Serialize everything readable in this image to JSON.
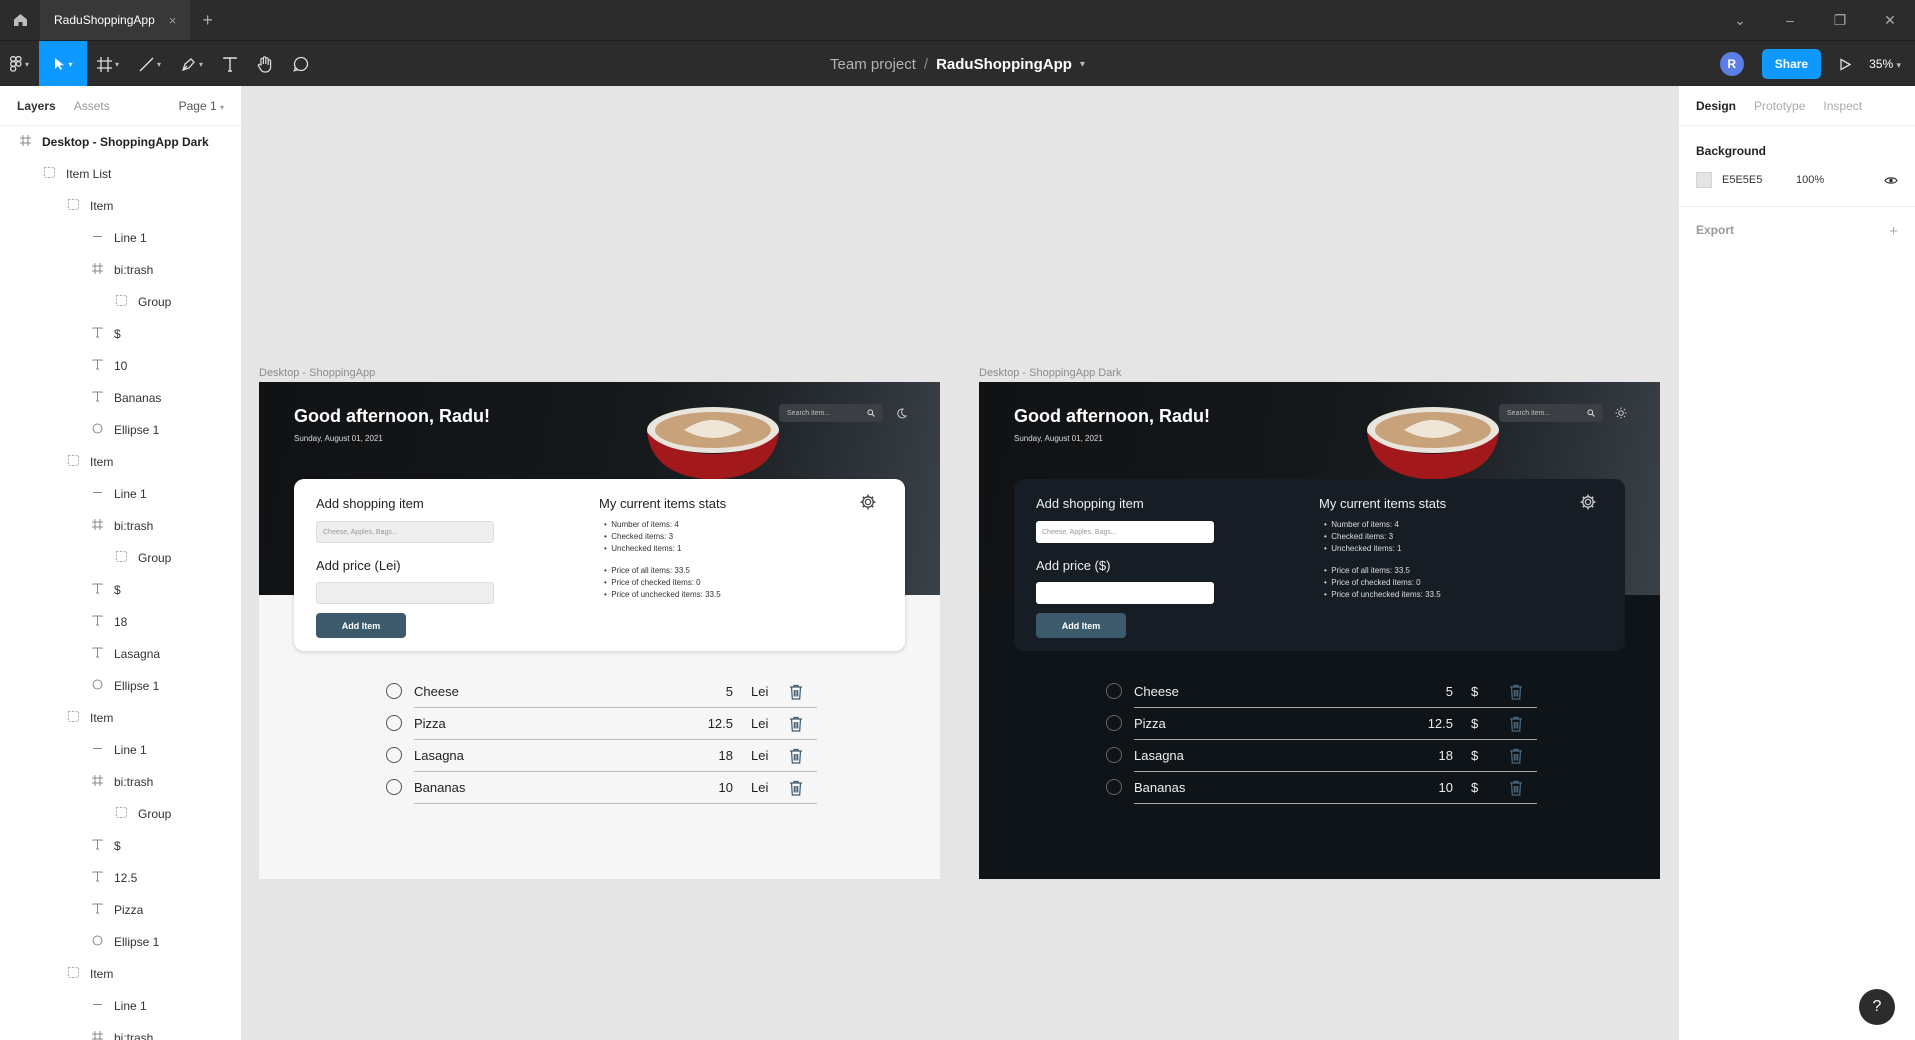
{
  "tabbar": {
    "tab_title": "RaduShoppingApp",
    "close": "×",
    "new_tab": "+"
  },
  "toolbar": {
    "project": "Team project",
    "separator": "/",
    "file": "RaduShoppingApp",
    "avatar": "R",
    "share": "Share",
    "zoom": "35%"
  },
  "left_panel": {
    "tabs": [
      "Layers",
      "Assets"
    ],
    "page": "Page 1",
    "layers": [
      {
        "label": "Desktop - ShoppingApp Dark",
        "icon": "frame-icon",
        "depth": 0
      },
      {
        "label": "Item List",
        "icon": "group-icon",
        "depth": 1
      },
      {
        "label": "Item",
        "icon": "group-icon",
        "depth": 2
      },
      {
        "label": "Line 1",
        "icon": "line-icon",
        "depth": 3
      },
      {
        "label": "bi:trash",
        "icon": "frame-icon",
        "depth": 3
      },
      {
        "label": "Group",
        "icon": "group-icon",
        "depth": 4
      },
      {
        "label": "$",
        "icon": "text-icon",
        "depth": 3
      },
      {
        "label": "10",
        "icon": "text-icon",
        "depth": 3
      },
      {
        "label": "Bananas",
        "icon": "text-icon",
        "depth": 3
      },
      {
        "label": "Ellipse 1",
        "icon": "ellipse-icon",
        "depth": 3
      },
      {
        "label": "Item",
        "icon": "group-icon",
        "depth": 2
      },
      {
        "label": "Line 1",
        "icon": "line-icon",
        "depth": 3
      },
      {
        "label": "bi:trash",
        "icon": "frame-icon",
        "depth": 3
      },
      {
        "label": "Group",
        "icon": "group-icon",
        "depth": 4
      },
      {
        "label": "$",
        "icon": "text-icon",
        "depth": 3
      },
      {
        "label": "18",
        "icon": "text-icon",
        "depth": 3
      },
      {
        "label": "Lasagna",
        "icon": "text-icon",
        "depth": 3
      },
      {
        "label": "Ellipse 1",
        "icon": "ellipse-icon",
        "depth": 3
      },
      {
        "label": "Item",
        "icon": "group-icon",
        "depth": 2
      },
      {
        "label": "Line 1",
        "icon": "line-icon",
        "depth": 3
      },
      {
        "label": "bi:trash",
        "icon": "frame-icon",
        "depth": 3
      },
      {
        "label": "Group",
        "icon": "group-icon",
        "depth": 4
      },
      {
        "label": "$",
        "icon": "text-icon",
        "depth": 3
      },
      {
        "label": "12.5",
        "icon": "text-icon",
        "depth": 3
      },
      {
        "label": "Pizza",
        "icon": "text-icon",
        "depth": 3
      },
      {
        "label": "Ellipse 1",
        "icon": "ellipse-icon",
        "depth": 3
      },
      {
        "label": "Item",
        "icon": "group-icon",
        "depth": 2
      },
      {
        "label": "Line 1",
        "icon": "line-icon",
        "depth": 3
      },
      {
        "label": "bi:trash",
        "icon": "frame-icon",
        "depth": 3
      }
    ]
  },
  "right_panel": {
    "tabs": [
      "Design",
      "Prototype",
      "Inspect"
    ],
    "background_label": "Background",
    "bg_hex": "E5E5E5",
    "bg_opacity": "100%",
    "export_label": "Export",
    "export_add": "+",
    "help": "?"
  },
  "frames": {
    "light": {
      "label": "Desktop - ShoppingApp",
      "greeting": "Good afternoon, Radu!",
      "date": "Sunday, August 01, 2021",
      "search_placeholder": "Search item...",
      "add_heading": "Add shopping item",
      "item_placeholder": "Cheese, Apples, Bags...",
      "price_heading": "Add price (Lei)",
      "add_button": "Add Item",
      "stats_heading": "My current items stats",
      "stats": [
        "Number of items: 4",
        "Checked items: 3",
        "Unchecked items: 1"
      ],
      "price_stats": [
        "Price of all items: 33.5",
        "Price of checked items: 0",
        "Price of unchecked items: 33.5"
      ],
      "currency": "Lei",
      "items": [
        {
          "name": "Cheese",
          "price": "5"
        },
        {
          "name": "Pizza",
          "price": "12.5"
        },
        {
          "name": "Lasagna",
          "price": "18"
        },
        {
          "name": "Bananas",
          "price": "10"
        }
      ]
    },
    "dark": {
      "label": "Desktop - ShoppingApp Dark",
      "greeting": "Good afternoon, Radu!",
      "date": "Sunday, August 01, 2021",
      "search_placeholder": "Search item...",
      "add_heading": "Add shopping item",
      "item_placeholder": "Cheese, Apples, Bags...",
      "price_heading": "Add price ($)",
      "add_button": "Add Item",
      "stats_heading": "My current items stats",
      "stats": [
        "Number of items: 4",
        "Checked items: 3",
        "Unchecked items: 1"
      ],
      "price_stats": [
        "Price of all items: 33.5",
        "Price of checked items: 0",
        "Price of unchecked items: 33.5"
      ],
      "currency": "$",
      "items": [
        {
          "name": "Cheese",
          "price": "5"
        },
        {
          "name": "Pizza",
          "price": "12.5"
        },
        {
          "name": "Lasagna",
          "price": "18"
        },
        {
          "name": "Bananas",
          "price": "10"
        }
      ]
    }
  },
  "colors": {
    "accent": "#0d99ff",
    "canvas": "#e5e5e5",
    "chrome": "#2c2c2c",
    "button": "#3d5a6c",
    "dark_frame": "#0f1419"
  }
}
